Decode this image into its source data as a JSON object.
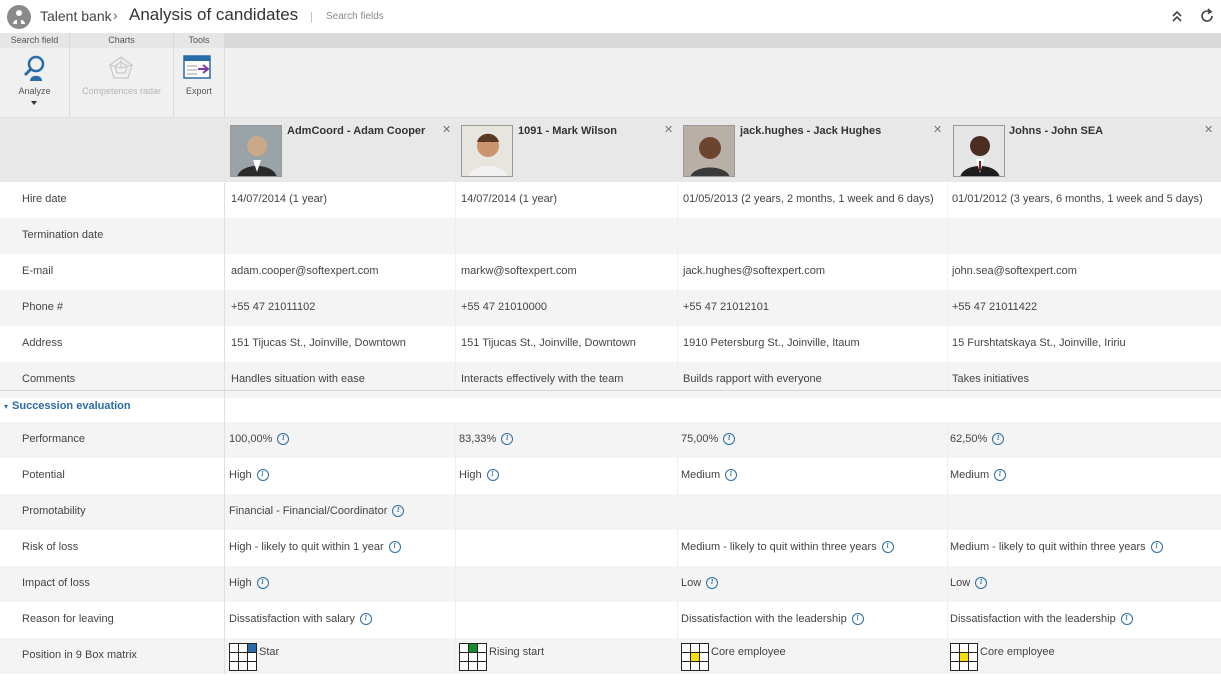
{
  "header": {
    "root_crumb": "Talent bank",
    "separator": "›",
    "title": "Analysis of candidates",
    "divider": "|",
    "search_label": "Search fields"
  },
  "ribbon": {
    "tabs": [
      "Search field",
      "Charts",
      "Tools"
    ],
    "buttons": {
      "analyze": "Analyze",
      "radar": "Competences radar",
      "export": "Export"
    }
  },
  "candidates": [
    {
      "name": "AdmCoord - Adam Cooper",
      "box_fill": [
        2,
        "#2a6ca8"
      ]
    },
    {
      "name": "1091 - Mark Wilson",
      "box_fill": [
        1,
        "#1a8c2e"
      ]
    },
    {
      "name": "jack.hughes - Jack Hughes",
      "box_fill": [
        4,
        "#f2e000"
      ]
    },
    {
      "name": "Johns - John SEA",
      "box_fill": [
        4,
        "#f2e000"
      ]
    }
  ],
  "rows": [
    {
      "label": "Hire date",
      "values": [
        "14/07/2014 (1 year)",
        "14/07/2014 (1 year)",
        "01/05/2013 (2 years, 2 months, 1 week and 6 days)",
        "01/01/2012 (3 years, 6 months, 1 week and 5 days)"
      ]
    },
    {
      "label": "Termination date",
      "values": [
        "",
        "",
        "",
        ""
      ]
    },
    {
      "label": "E-mail",
      "values": [
        "adam.cooper@softexpert.com",
        "markw@softexpert.com",
        "jack.hughes@softexpert.com",
        "john.sea@softexpert.com"
      ]
    },
    {
      "label": "Phone #",
      "values": [
        "+55 47 21011102",
        "+55 47 21010000",
        "+55 47 21012101",
        "+55 47 21011422"
      ]
    },
    {
      "label": "Address",
      "values": [
        "151 Tijucas St., Joinville, Downtown",
        "151 Tijucas St., Joinville, Downtown",
        "1910 Petersburg St., Joinville, Itaum",
        "15 Furshtatskaya St., Joinville, Iririu"
      ]
    },
    {
      "label": "Comments",
      "values": [
        "Handles situation with ease",
        "Interacts effectively with the team",
        "Builds rapport with everyone",
        "Takes initiatives"
      ]
    }
  ],
  "section": {
    "toggle": "▾",
    "title": "Succession evaluation",
    "rows": [
      {
        "label": "Performance",
        "values": [
          "100,00%",
          "83,33%",
          "75,00%",
          "62,50%"
        ],
        "info": [
          true,
          true,
          true,
          true
        ]
      },
      {
        "label": "Potential",
        "values": [
          "High",
          "High",
          "Medium",
          "Medium"
        ],
        "info": [
          true,
          true,
          true,
          true
        ]
      },
      {
        "label": "Promotability",
        "values": [
          "Financial - Financial/Coordinator",
          "",
          "",
          ""
        ],
        "info": [
          true,
          false,
          false,
          false
        ]
      },
      {
        "label": "Risk of loss",
        "values": [
          "High - likely to quit within 1 year",
          "",
          "Medium - likely to quit within three years",
          "Medium - likely to quit within three years"
        ],
        "info": [
          true,
          false,
          true,
          true
        ]
      },
      {
        "label": "Impact of loss",
        "values": [
          "High",
          "",
          "Low",
          "Low"
        ],
        "info": [
          true,
          false,
          true,
          true
        ]
      },
      {
        "label": "Reason for leaving",
        "values": [
          "Dissatisfaction with salary",
          "",
          "Dissatisfaction with the leadership",
          "Dissatisfaction with the leadership"
        ],
        "info": [
          true,
          false,
          true,
          true
        ]
      },
      {
        "label": "Position in 9 Box matrix",
        "values": [
          "Star",
          "Rising start",
          "Core employee",
          "Core employee"
        ],
        "box": true
      }
    ]
  },
  "colors": {
    "accent": "#2a6ca8",
    "header_bg": "#e8e8e8",
    "alt_row": "#f4f4f4"
  }
}
